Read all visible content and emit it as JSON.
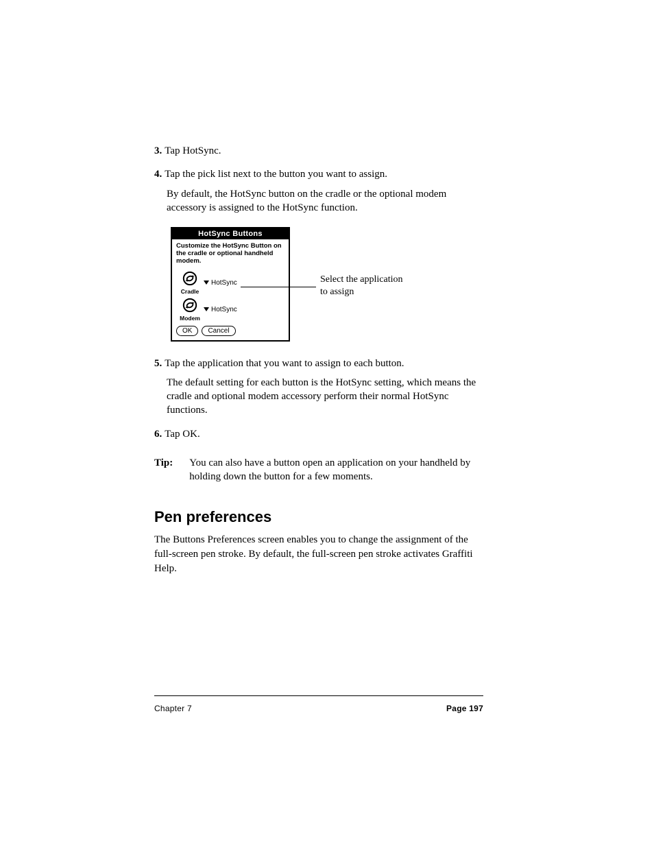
{
  "steps": {
    "s3": {
      "num": "3.",
      "text": "Tap HotSync."
    },
    "s4": {
      "num": "4.",
      "text": "Tap the pick list next to the button you want to assign.",
      "sub": "By default, the HotSync button on the cradle or the optional modem accessory is assigned to the HotSync function."
    },
    "s5": {
      "num": "5.",
      "text": "Tap the application that you want to assign to each button.",
      "sub": "The default setting for each button is the HotSync setting, which means the cradle and optional modem accessory perform their normal HotSync functions."
    },
    "s6": {
      "num": "6.",
      "text": "Tap OK."
    }
  },
  "dialog": {
    "title": "HotSync Buttons",
    "desc": "Customize the HotSync Button on the cradle or optional handheld modem.",
    "rows": [
      {
        "iconLabel": "Cradle",
        "picker": "HotSync"
      },
      {
        "iconLabel": "Modem",
        "picker": "HotSync"
      }
    ],
    "ok": "OK",
    "cancel": "Cancel"
  },
  "callout": "Select the application to assign",
  "note": {
    "label": "Tip:",
    "body": "You can also have a button open an application on your handheld by holding down the button for a few moments."
  },
  "section": {
    "title": "Pen preferences",
    "body": "The Buttons Preferences screen enables you to change the assignment of the full-screen pen stroke. By default, the full-screen pen stroke activates Graffiti Help."
  },
  "footer": {
    "left": "Chapter 7",
    "right": "Page 197"
  }
}
